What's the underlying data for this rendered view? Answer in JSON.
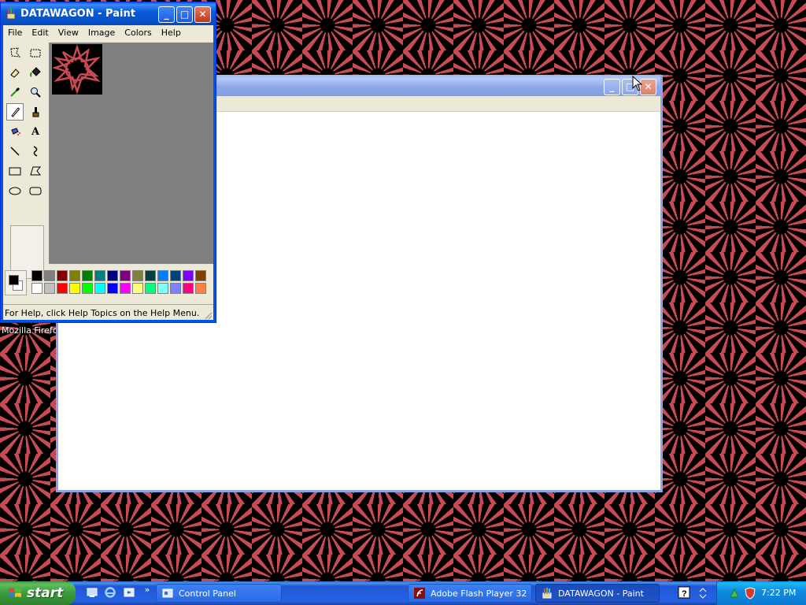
{
  "desktop": {
    "icon_label": "Mozilla Firefox"
  },
  "background_window": {
    "buttons": [
      "minimize",
      "maximize",
      "close"
    ]
  },
  "paint": {
    "title": "DATAWAGON - Paint",
    "menu": [
      "File",
      "Edit",
      "View",
      "Image",
      "Colors",
      "Help"
    ],
    "tools": [
      "free-form-select",
      "select",
      "eraser",
      "fill-with-color",
      "pick-color",
      "magnifier",
      "pencil",
      "brush",
      "airbrush",
      "text",
      "line",
      "curve",
      "rectangle",
      "polygon",
      "ellipse",
      "rounded-rectangle"
    ],
    "selected_tool": "pencil",
    "text_tool_glyph": "A",
    "status": "For Help, click Help Topics on the Help Menu.",
    "palette_top": [
      "#000000",
      "#808080",
      "#800000",
      "#808000",
      "#008000",
      "#008080",
      "#000080",
      "#800080",
      "#808040",
      "#004040",
      "#0080ff",
      "#004080",
      "#8000ff",
      "#804000"
    ],
    "palette_bottom": [
      "#ffffff",
      "#c0c0c0",
      "#ff0000",
      "#ffff00",
      "#00ff00",
      "#00ffff",
      "#0000ff",
      "#ff00ff",
      "#ffff80",
      "#00ff80",
      "#80ffff",
      "#8080ff",
      "#ff0080",
      "#ff8040"
    ],
    "foreground": "#000000",
    "background": "#ffffff"
  },
  "taskbar": {
    "start_label": "start",
    "buttons": [
      {
        "label": "Control Panel",
        "active": false
      },
      {
        "label": "Adobe Flash Player 32",
        "active": false
      },
      {
        "label": "DATAWAGON - Paint",
        "active": true
      }
    ],
    "overflow": "»",
    "clock": "7:22 PM"
  }
}
